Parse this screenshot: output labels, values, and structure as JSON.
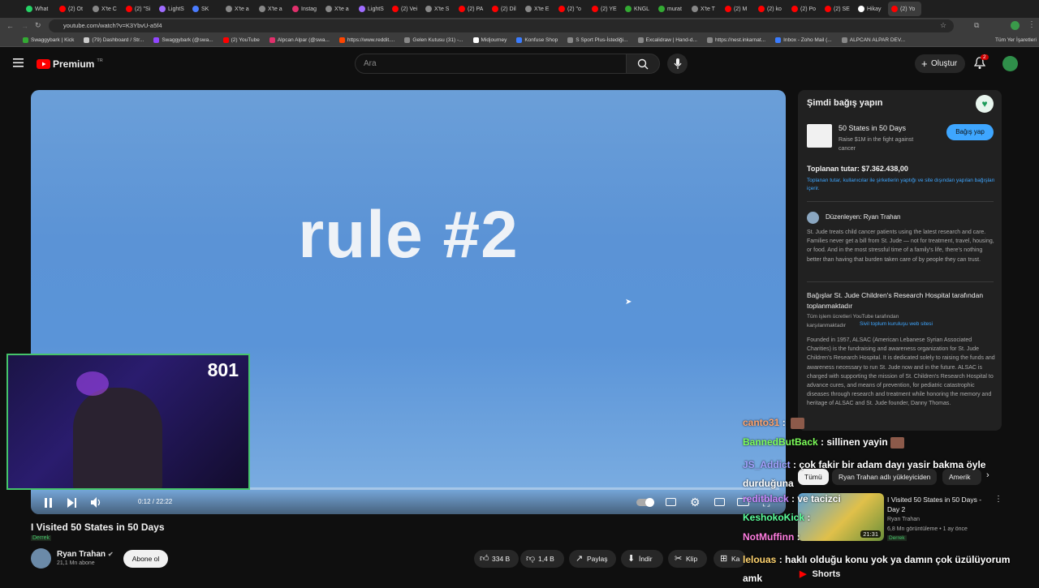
{
  "browser": {
    "tabs": [
      "What",
      "(2) Ot",
      "X'te C",
      "(2) \"Si",
      "LightS",
      "SK",
      "X'te a",
      "X'te a",
      "Instag",
      "X'te a",
      "LightS",
      "(2) Vei",
      "X'te S",
      "(2) PA",
      "(2) Dil",
      "X'te E",
      "(2) \"o",
      "(2) YE",
      "KNGL",
      "murat",
      "X'te T",
      "(2) M",
      "(2) ko",
      "(2) Po",
      "(2) SE",
      "Hikay",
      "(2) Yo"
    ],
    "url": "youtube.com/watch?v=K3YbvU-a5f4",
    "bookmarks": [
      "Swaggybark | Kick",
      "(79) Dashboard / Str...",
      "Swaggybark (@swa...",
      "(2) YouTube",
      "Alpcan Alpar (@swa...",
      "https://www.reddit....",
      "Gelen Kutusu (31) -...",
      "Midjourney",
      "Konfuse Shop",
      "S Sport Plus-İstediği...",
      "Excalidraw | Hand-d...",
      "https://nest.inkarnat...",
      "Inbox - Zoho Mail (...",
      "ALPCAN ALPAR DEV..."
    ],
    "all_bookmarks": "Tüm Yer İşaretleri"
  },
  "header": {
    "brand": "Premium",
    "brand_sup": "TR",
    "search_placeholder": "Ara",
    "create_label": "Oluştur",
    "notif_count": "2"
  },
  "player": {
    "overlay_text": "rule #2",
    "progress": 0.009,
    "time": "0:12 / 22:22"
  },
  "cam": {
    "viewers": "801"
  },
  "video": {
    "title": "I Visited 50 States in 50 Days",
    "tag": "Derrek",
    "channel": "Ryan Trahan",
    "subs": "21,1 Mn abone",
    "subscribe": "Abone ol",
    "likes": "334 B",
    "dislikes": "1,4 B",
    "share": "Paylaş",
    "download": "İndir",
    "clip": "Klip",
    "save": "Ka"
  },
  "donation": {
    "header": "Şimdi bağış yapın",
    "campaign_title": "50 States in 50 Days",
    "campaign_desc": "Raise $1M in the fight against cancer",
    "donate_btn": "Bağış yap",
    "total": "Toplanan tutar: $7.362.438,00",
    "total_note": "Toplanan tutar, kullanıcılar ile şirketlerin yaptığı ve site dışından yapılan bağışları içerir.",
    "organizer": "Düzenleyen: Ryan Trahan",
    "desc": "St. Jude treats child cancer patients using the latest research and care. Families never get a bill from St. Jude — not for treatment, travel, housing, or food. And in the most stressful time of a family's life, there's nothing better than having that burden taken care of by people they can trust.",
    "org_title": "Bağışlar St. Jude Children's Research Hospital tarafından toplanmaktadır",
    "org_sub1": "Tüm işlem ücretleri YouTube tarafından karşılanmaktadır",
    "org_link": "Sivil toplum kuruluşu web sitesi",
    "org_desc": "Founded in 1957, ALSAC (American Lebanese Syrian Associated Charities) is the fundraising and awareness organization for St. Jude Children's Research Hospital. It is dedicated solely to raising the funds and awareness necessary to run St. Jude now and in the future. ALSAC is charged with supporting the mission of St. Children's Research Hospital to advance cures, and means of prevention, for pediatric catastrophic diseases through research and treatment while honoring the memory and heritage of ALSAC and St. Jude founder, Danny Thomas."
  },
  "chips": [
    "Tümü",
    "Ryan Trahan adlı yükleyiciden",
    "Amerik"
  ],
  "recommendation": {
    "title": "I Visited 50 States in 50 Days - Day 2",
    "channel": "Ryan Trahan",
    "meta": "6,8 Mn görüntüleme • 1 ay önce",
    "tag": "Derrek",
    "duration": "21:31",
    "shorts": "Shorts"
  },
  "chat": [
    {
      "user": "canto31",
      "msg": "",
      "color": "#ffa46e"
    },
    {
      "user": "BannedButBack",
      "msg": "sillinen yayin",
      "color": "#7dff5a"
    },
    {
      "user": "JS_Addict",
      "msg": "çok fakir bir adam dayı yasir bakma öyle durduğuna",
      "color": "#a1a1ff"
    },
    {
      "user": "reditblack",
      "msg": "ve tacizci",
      "color": "#c988ff"
    },
    {
      "user": "KeshokoKick",
      "msg": "",
      "color": "#5aff9a"
    },
    {
      "user": "NotMuffinn",
      "msg": "",
      "color": "#ff7de0"
    },
    {
      "user": "lelouas",
      "msg": "haklı olduğu konu yok ya damın çok üzülüyorum amk",
      "color": "#ffd36e"
    }
  ]
}
